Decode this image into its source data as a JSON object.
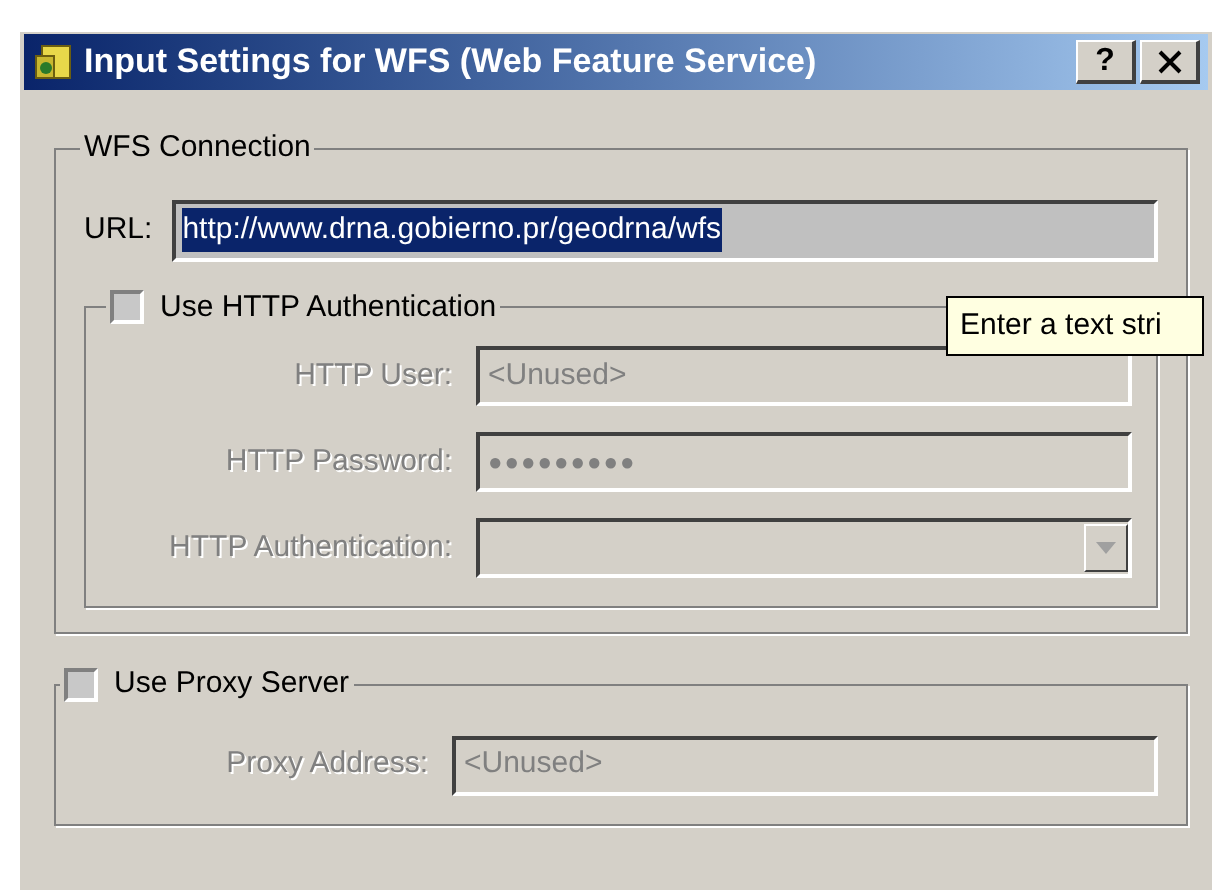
{
  "window": {
    "title": "Input Settings for WFS (Web Feature Service)",
    "help_button": "?"
  },
  "wfs_connection": {
    "title": "WFS Connection",
    "url": {
      "label": "URL:",
      "value": "http://www.drna.gobierno.pr/geodrna/wfs",
      "selected": true
    },
    "http_authentication": {
      "label": "Use HTTP Authentication",
      "checked": false,
      "fields": [
        {
          "kind": "text",
          "label": "HTTP User:",
          "value": "<Unused>",
          "disabled": true
        },
        {
          "kind": "password",
          "label": "HTTP Password:",
          "value": "●●●●●●●●●",
          "disabled": true
        },
        {
          "kind": "dropdown",
          "label": "HTTP Authentication:",
          "disabled": true
        }
      ]
    }
  },
  "tooltip": {
    "text": "Enter a text stri"
  },
  "proxy": {
    "label": "Use Proxy Server",
    "checked": false,
    "fields": [
      {
        "kind": "text",
        "label": "Proxy Address:",
        "value": "<Unused>",
        "disabled": true
      }
    ]
  }
}
